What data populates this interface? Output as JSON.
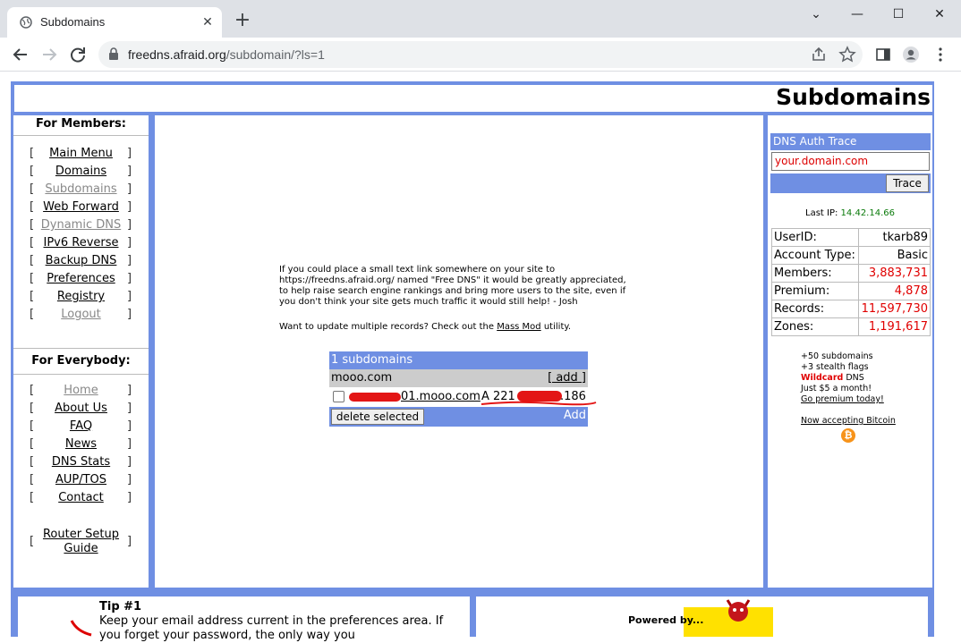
{
  "browser": {
    "tab_title": "Subdomains",
    "url_host": "freedns.afraid.org",
    "url_path": "/subdomain/?ls=1"
  },
  "header": {
    "title": "Subdomains"
  },
  "left": {
    "members_heading": "For Members:",
    "members_items": [
      {
        "label": "Main Menu",
        "dim": false
      },
      {
        "label": "Domains",
        "dim": false
      },
      {
        "label": "Subdomains",
        "dim": true
      },
      {
        "label": "Web Forward",
        "dim": false
      },
      {
        "label": "Dynamic DNS",
        "dim": true
      },
      {
        "label": "IPv6 Reverse",
        "dim": false
      },
      {
        "label": "Backup DNS",
        "dim": false
      },
      {
        "label": "Preferences",
        "dim": false
      },
      {
        "label": "Registry",
        "dim": false
      },
      {
        "label": "Logout",
        "dim": true
      }
    ],
    "everybody_heading": "For Everybody:",
    "everybody_items": [
      {
        "label": "Home",
        "dim": true
      },
      {
        "label": "About Us",
        "dim": false
      },
      {
        "label": "FAQ",
        "dim": false
      },
      {
        "label": "News",
        "dim": false
      },
      {
        "label": "DNS Stats",
        "dim": false
      },
      {
        "label": "AUP/TOS",
        "dim": false
      },
      {
        "label": "Contact",
        "dim": false
      }
    ],
    "router_line1": "Router Setup",
    "router_line2": "Guide",
    "bracket_left": "[",
    "bracket_right": "]"
  },
  "main": {
    "para1_line1": "If you could place a small text link somewhere on your site to",
    "para1_line2": "https://freedns.afraid.org/ named \"Free DNS\" it would be greatly appreciated,",
    "para1_line3": "to help raise search engine rankings and bring more users to the site, even if",
    "para1_line4": "you don't think your site gets much traffic it would still help! - Josh",
    "para2_prefix": "Want to update multiple records? Check out the",
    "para2_link": "Mass Mod",
    "para2_suffix": "utility.",
    "table": {
      "header": "1 subdomains",
      "domain": "mooo.com",
      "add_link": "[ add ]",
      "record_host": "01.mooo.com",
      "record_type": "A",
      "record_ip_start": "221",
      "record_ip_end": ".186",
      "delete_button": "delete selected",
      "add_button": "Add"
    }
  },
  "right": {
    "dns_trace_title": "DNS Auth Trace",
    "dns_input_placeholder": "your.domain.com",
    "trace_button": "Trace",
    "last_ip_label": "Last IP:",
    "last_ip_value": "14.42.14.66",
    "stats": [
      {
        "label": "UserID:",
        "value": "tkarb89",
        "red": false
      },
      {
        "label": "Account Type:",
        "value": "Basic",
        "red": false
      },
      {
        "label": "Members:",
        "value": "3,883,731",
        "red": true
      },
      {
        "label": "Premium:",
        "value": "4,878",
        "red": true
      },
      {
        "label": "Records:",
        "value": "11,597,730",
        "red": true
      },
      {
        "label": "Zones:",
        "value": "1,191,617",
        "red": true
      }
    ],
    "promo_line1": "+50 subdomains",
    "promo_line2": "+3 stealth flags",
    "promo_wildcard": "Wildcard",
    "promo_dns": "DNS",
    "promo_line4": "Just $5 a month!",
    "promo_link": "Go premium today!",
    "bitcoin_link": "Now accepting Bitcoin",
    "bitcoin_symbol": "₿"
  },
  "footer": {
    "tip_title": "Tip #1",
    "tip_text": "Keep your email address current in the preferences area. If you forget your password, the only way you",
    "powered_by": "Powered by..."
  },
  "colors": {
    "frame_blue": "#6f8fe3",
    "stat_red": "#e00000",
    "ip_green": "#0a7a0a"
  }
}
